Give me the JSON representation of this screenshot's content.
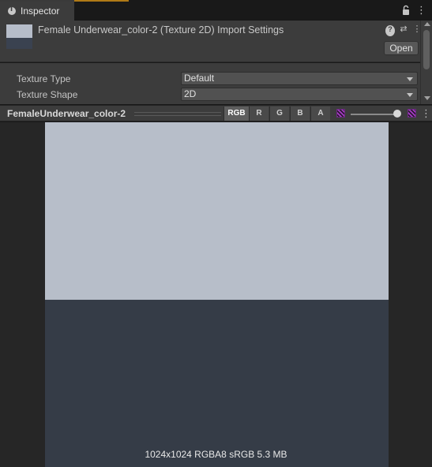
{
  "tab": {
    "label": "Inspector"
  },
  "header": {
    "title": "Female Underwear_color-2 (Texture 2D) Import Settings",
    "open_button": "Open",
    "thumbnail_colors": [
      "#b6bdc9",
      "#3a4250"
    ]
  },
  "icons": {
    "tab": "info-icon",
    "lock": "lock-icon",
    "menu": "kebab-menu-icon",
    "help": "help-icon",
    "preset": "preset-sliders-icon"
  },
  "properties": [
    {
      "label": "Texture Type",
      "value": "Default"
    },
    {
      "label": "Texture Shape",
      "value": "2D"
    }
  ],
  "preview": {
    "name": "FemaleUnderwear_color-2",
    "channels": [
      "RGB",
      "R",
      "G",
      "B",
      "A"
    ],
    "active_channel": "RGB",
    "texture_colors": {
      "top": "#b7bec9",
      "bottom": "#353c47"
    },
    "info": "1024x1024  RGBA8 sRGB   5.3 MB"
  },
  "colors": {
    "accent": "#b07a16",
    "panel": "#3c3c3c",
    "background": "#191919"
  }
}
